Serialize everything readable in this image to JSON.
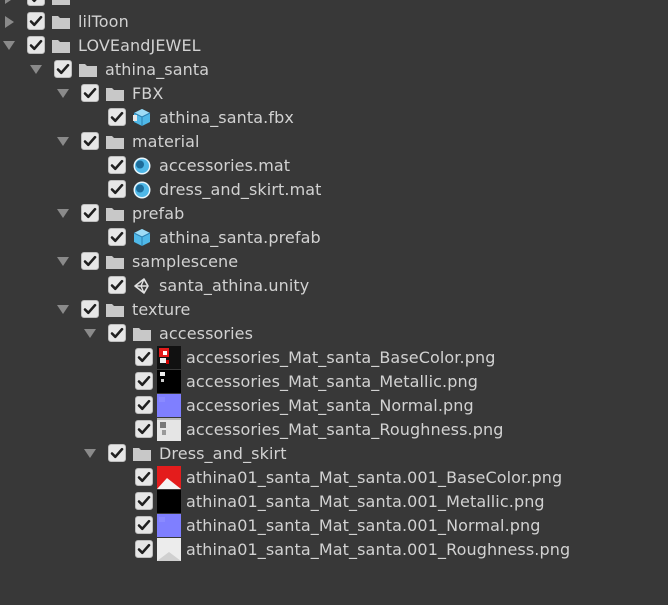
{
  "project_tree": {
    "rows": [
      {
        "label": "",
        "cut": true
      },
      {
        "label": "lilToon"
      },
      {
        "label": "LOVEandJEWEL"
      },
      {
        "label": "athina_santa"
      },
      {
        "label": "FBX"
      },
      {
        "label": "athina_santa.fbx"
      },
      {
        "label": "material"
      },
      {
        "label": "accessories.mat"
      },
      {
        "label": "dress_and_skirt.mat"
      },
      {
        "label": "prefab"
      },
      {
        "label": "athina_santa.prefab"
      },
      {
        "label": "samplescene"
      },
      {
        "label": "santa_athina.unity"
      },
      {
        "label": "texture"
      },
      {
        "label": "accessories"
      },
      {
        "label": "accessories_Mat_santa_BaseColor.png"
      },
      {
        "label": "accessories_Mat_santa_Metallic.png"
      },
      {
        "label": "accessories_Mat_santa_Normal.png"
      },
      {
        "label": "accessories_Mat_santa_Roughness.png"
      },
      {
        "label": "Dress_and_skirt"
      },
      {
        "label": "athina01_santa_Mat_santa.001_BaseColor.png"
      },
      {
        "label": "athina01_santa_Mat_santa.001_Metallic.png"
      },
      {
        "label": "athina01_santa_Mat_santa.001_Normal.png"
      },
      {
        "label": "athina01_santa_Mat_santa.001_Roughness.png"
      }
    ]
  },
  "colors": {
    "background": "#383838",
    "text": "#d2d2d2",
    "checkbox": "#e6e6e6",
    "folder": "#c8c8c8",
    "asset_blue": "#4fb8e8",
    "normal_map": "#7f7fff"
  }
}
